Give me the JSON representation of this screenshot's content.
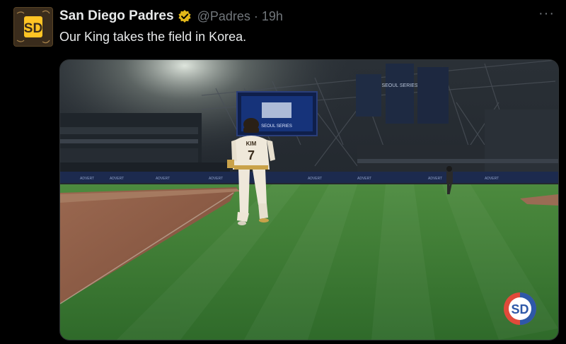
{
  "tweet": {
    "author_name": "San Diego Padres",
    "handle": "@Padres",
    "separator": "·",
    "time": "19h",
    "text": "Our King takes the field in Korea.",
    "more_label": "···"
  },
  "media": {
    "jumbotron_title": "SEOUL SERIES",
    "banner_text": "SEOUL SERIES",
    "player_name": "KIM",
    "player_number": "7",
    "logo_text": "SD"
  },
  "colors": {
    "verified_badge": "#e2b719",
    "brand_brown": "#3a2c1c",
    "brand_gold": "#ffc425",
    "grass": "#3f7a35",
    "dirt": "#8b5a44"
  }
}
